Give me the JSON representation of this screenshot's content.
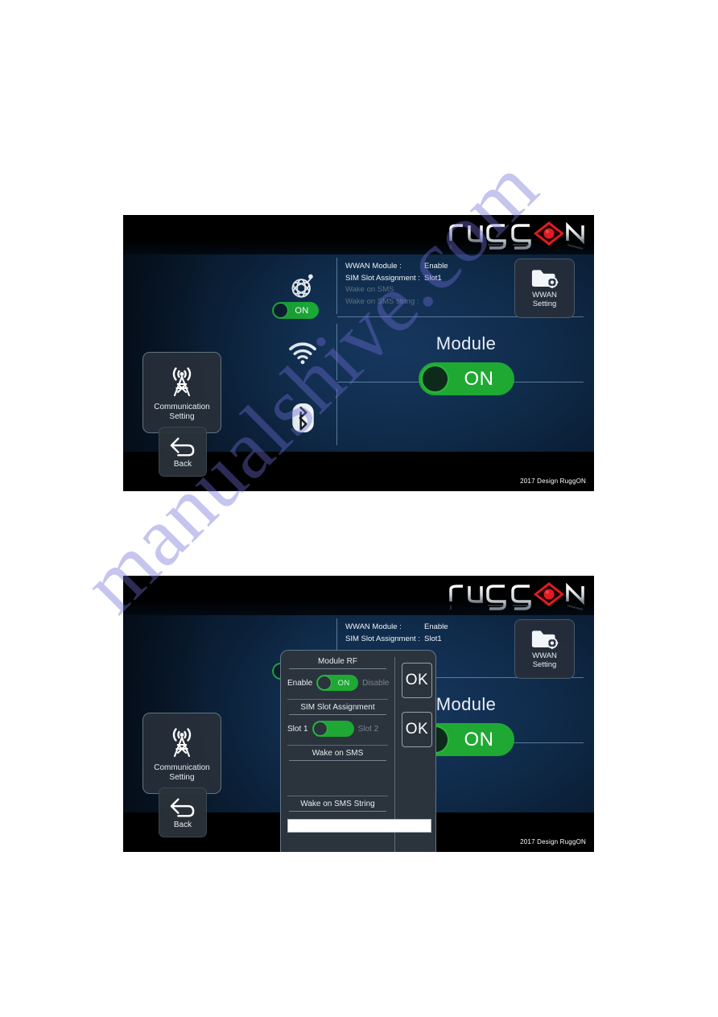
{
  "document": {
    "watermark_text": "manualshive.com"
  },
  "brand": {
    "logo_text": "ruggON",
    "logo_accent_color": "#e11b22"
  },
  "screen_one": {
    "footer_credit": "2017 Design RuggON",
    "nav": {
      "communication_tile_label_line1": "Communication",
      "communication_tile_label_line2": "Setting",
      "back_label": "Back"
    },
    "rows": {
      "wwan_icon": "satellite-globe-icon",
      "wifi_icon": "wifi-icon",
      "bluetooth_icon": "bluetooth-icon"
    },
    "wwan_toggle": {
      "state_label": "ON",
      "on_color": "#1aa836"
    },
    "info": [
      {
        "key": "WWAN Module :",
        "value": "Enable",
        "dim": false
      },
      {
        "key": "SIM Slot Assignment :",
        "value": "Slot1",
        "dim": false
      },
      {
        "key": "Wake on SMS",
        "value": "",
        "dim": true
      },
      {
        "key": "Wake on SMS string :",
        "value": "",
        "dim": true
      }
    ],
    "wwan_setting_tile": {
      "label_line1": "WWAN",
      "label_line2": "Setting",
      "icon": "folder-gear-icon"
    },
    "module": {
      "title": "Module",
      "toggle_label": "ON",
      "on_color": "#1fa933"
    }
  },
  "screen_two": {
    "footer_credit": "2017 Design RuggON",
    "nav": {
      "communication_tile_label_line1": "Communication",
      "communication_tile_label_line2": "Setting",
      "back_label": "Back"
    },
    "info": [
      {
        "key": "WWAN Module :",
        "value": "Enable",
        "dim": false
      },
      {
        "key": "SIM Slot Assignment :",
        "value": "Slot1",
        "dim": false
      }
    ],
    "wwan_setting_tile": {
      "label_line1": "WWAN",
      "label_line2": "Setting",
      "icon": "folder-gear-icon"
    },
    "module": {
      "title": "Module",
      "toggle_label": "ON"
    },
    "dialog": {
      "module_rf": {
        "heading": "Module RF",
        "left_label": "Enable",
        "toggle_label": "ON",
        "right_label": "Disable",
        "ok_label": "OK"
      },
      "sim_slot": {
        "heading": "SIM Slot Assignment",
        "left_label": "Slot 1",
        "toggle_label": "",
        "right_label": "Slot 2",
        "ok_label": "OK"
      },
      "wake_on_sms": {
        "heading": "Wake on SMS"
      },
      "wake_on_sms_string": {
        "heading": "Wake on SMS String",
        "input_value": "",
        "input_placeholder": ""
      }
    }
  }
}
